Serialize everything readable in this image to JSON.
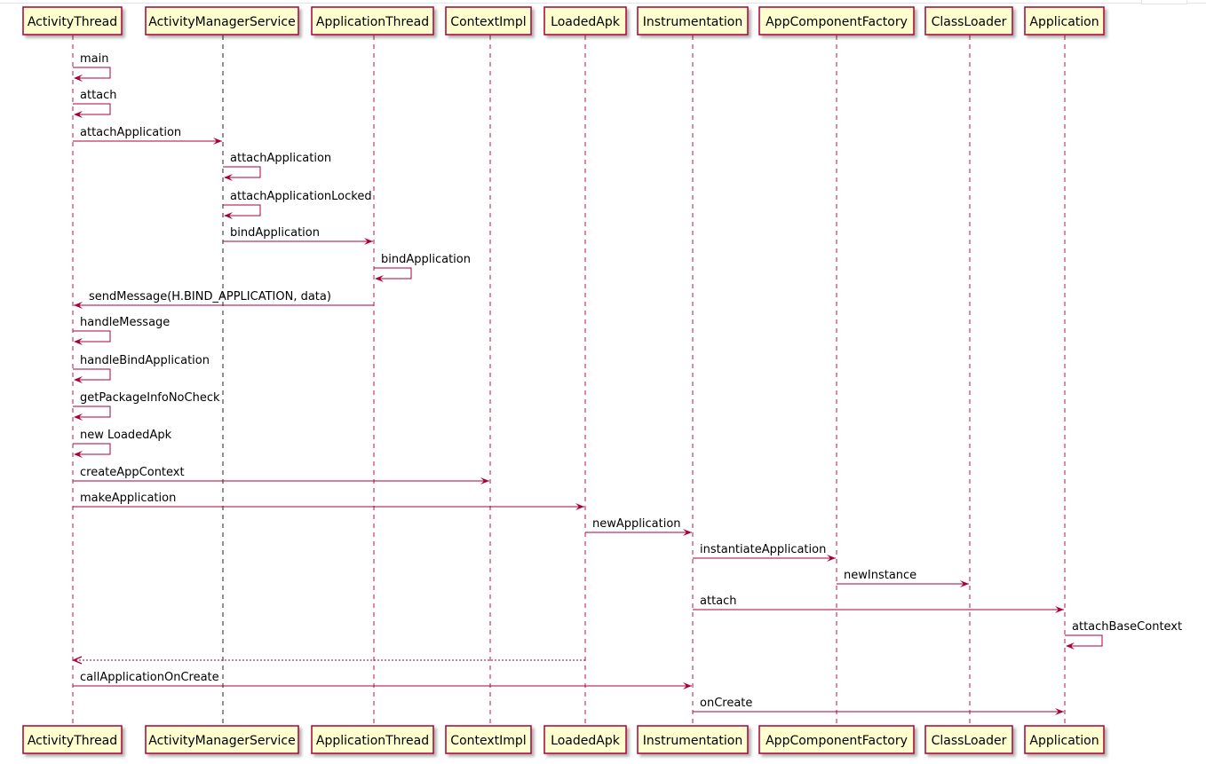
{
  "colors": {
    "border": "#A80036",
    "fill": "#FEFECE",
    "lifeline": "#A80036",
    "text": "#000000"
  },
  "participants": [
    {
      "id": "at",
      "name": "ActivityThread"
    },
    {
      "id": "ams",
      "name": "ActivityManagerService"
    },
    {
      "id": "apt",
      "name": "ApplicationThread"
    },
    {
      "id": "ci",
      "name": "ContextImpl"
    },
    {
      "id": "la",
      "name": "LoadedApk"
    },
    {
      "id": "ins",
      "name": "Instrumentation"
    },
    {
      "id": "acf",
      "name": "AppComponentFactory"
    },
    {
      "id": "cl",
      "name": "ClassLoader"
    },
    {
      "id": "app",
      "name": "Application"
    }
  ],
  "messages": [
    {
      "from": "at",
      "to": "at",
      "label": "main"
    },
    {
      "from": "at",
      "to": "at",
      "label": "attach"
    },
    {
      "from": "at",
      "to": "ams",
      "label": "attachApplication"
    },
    {
      "from": "ams",
      "to": "ams",
      "label": "attachApplication"
    },
    {
      "from": "ams",
      "to": "ams",
      "label": "attachApplicationLocked"
    },
    {
      "from": "ams",
      "to": "apt",
      "label": "bindApplication"
    },
    {
      "from": "apt",
      "to": "apt",
      "label": "bindApplication"
    },
    {
      "from": "apt",
      "to": "at",
      "label": "sendMessage(H.BIND_APPLICATION, data)"
    },
    {
      "from": "at",
      "to": "at",
      "label": "handleMessage"
    },
    {
      "from": "at",
      "to": "at",
      "label": "handleBindApplication"
    },
    {
      "from": "at",
      "to": "at",
      "label": "getPackageInfoNoCheck"
    },
    {
      "from": "at",
      "to": "at",
      "label": "new LoadedApk"
    },
    {
      "from": "at",
      "to": "ci",
      "label": "createAppContext"
    },
    {
      "from": "at",
      "to": "la",
      "label": "makeApplication"
    },
    {
      "from": "la",
      "to": "ins",
      "label": "newApplication"
    },
    {
      "from": "ins",
      "to": "acf",
      "label": "instantiateApplication"
    },
    {
      "from": "acf",
      "to": "cl",
      "label": "newInstance"
    },
    {
      "from": "ins",
      "to": "app",
      "label": "attach"
    },
    {
      "from": "app",
      "to": "app",
      "label": "attachBaseContext"
    },
    {
      "from": "la",
      "to": "at",
      "label": "",
      "dotted": true
    },
    {
      "from": "at",
      "to": "ins",
      "label": "callApplicationOnCreate"
    },
    {
      "from": "ins",
      "to": "app",
      "label": "onCreate"
    }
  ]
}
